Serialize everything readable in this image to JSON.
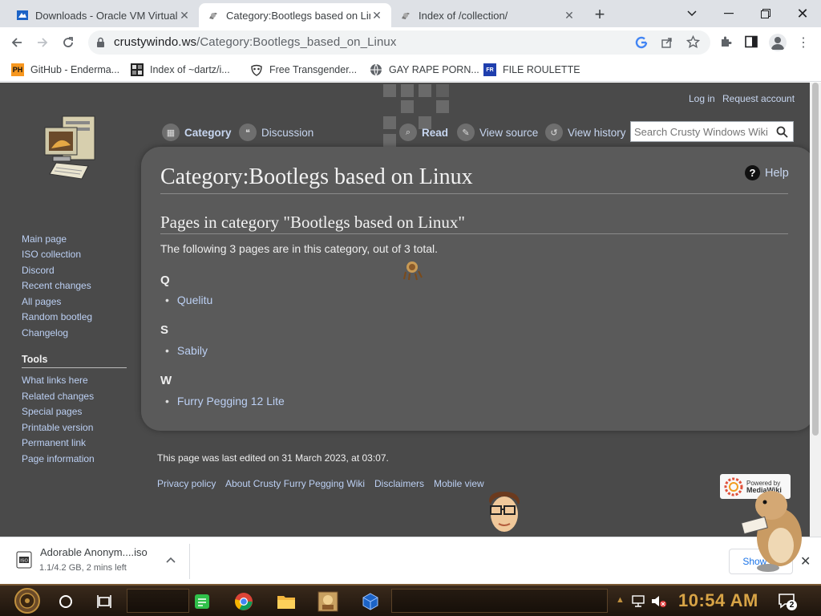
{
  "tabs": [
    {
      "title": "Downloads - Oracle VM VirtualBox",
      "active": false
    },
    {
      "title": "Category:Bootlegs based on Linux",
      "active": true
    },
    {
      "title": "Index of /collection/",
      "active": false
    }
  ],
  "toolbar": {
    "url_host": "crustywindo.ws",
    "url_path": "/Category:Bootlegs_based_on_Linux"
  },
  "bookmarks": [
    {
      "label": "GitHub - Enderma...",
      "icon": "ph-icon"
    },
    {
      "label": "Index of ~dartz/i...",
      "icon": "pixel-icon"
    },
    {
      "label": "Free Transgender...",
      "icon": "mask-icon"
    },
    {
      "label": "GAY RAPE PORN...",
      "icon": "globe-icon"
    },
    {
      "label": "FILE ROULETTE",
      "icon": "file-roulette-icon"
    }
  ],
  "wiki": {
    "personal": {
      "login": "Log in",
      "request": "Request account"
    },
    "nav": {
      "category": "Category",
      "discussion": "Discussion",
      "read": "Read",
      "view_source": "View source",
      "view_history": "View history"
    },
    "search_placeholder": "Search Crusty Windows Wiki",
    "sidebar": {
      "main": [
        "Main page",
        "ISO collection",
        "Discord",
        "Recent changes",
        "All pages",
        "Random bootleg",
        "Changelog"
      ],
      "tools_heading": "Tools",
      "tools": [
        "What links here",
        "Related changes",
        "Special pages",
        "Printable version",
        "Permanent link",
        "Page information"
      ]
    },
    "help": "Help",
    "title": "Category:Bootlegs based on Linux",
    "subtitle": "Pages in category \"Bootlegs based on Linux\"",
    "count_text": "The following 3 pages are in this category, out of 3 total.",
    "groups": [
      {
        "letter": "Q",
        "pages": [
          "Quelitu"
        ]
      },
      {
        "letter": "S",
        "pages": [
          "Sabily"
        ]
      },
      {
        "letter": "W",
        "pages": [
          "Furry Pegging 12 Lite"
        ]
      }
    ],
    "footer": {
      "last_edited": "This page was last edited on 31 March 2023, at 03:07.",
      "links": [
        "Privacy policy",
        "About Crusty Furry Pegging Wiki",
        "Disclaimers",
        "Mobile view"
      ],
      "powered_by": "Powered by",
      "mediawiki": "MediaWiki"
    }
  },
  "download": {
    "filename": "Adorable Anonym....iso",
    "status": "1.1/4.2 GB, 2 mins left",
    "show_all": "Show all"
  },
  "taskbar": {
    "time": "10:54 AM",
    "notification_count": "2"
  },
  "colors": {
    "wiki_bg": "#4a4a4a",
    "content_bg": "#5a5a5a",
    "link": "#bcd0f4",
    "taskbar": "#2a1e14",
    "clock": "#d8a446"
  }
}
